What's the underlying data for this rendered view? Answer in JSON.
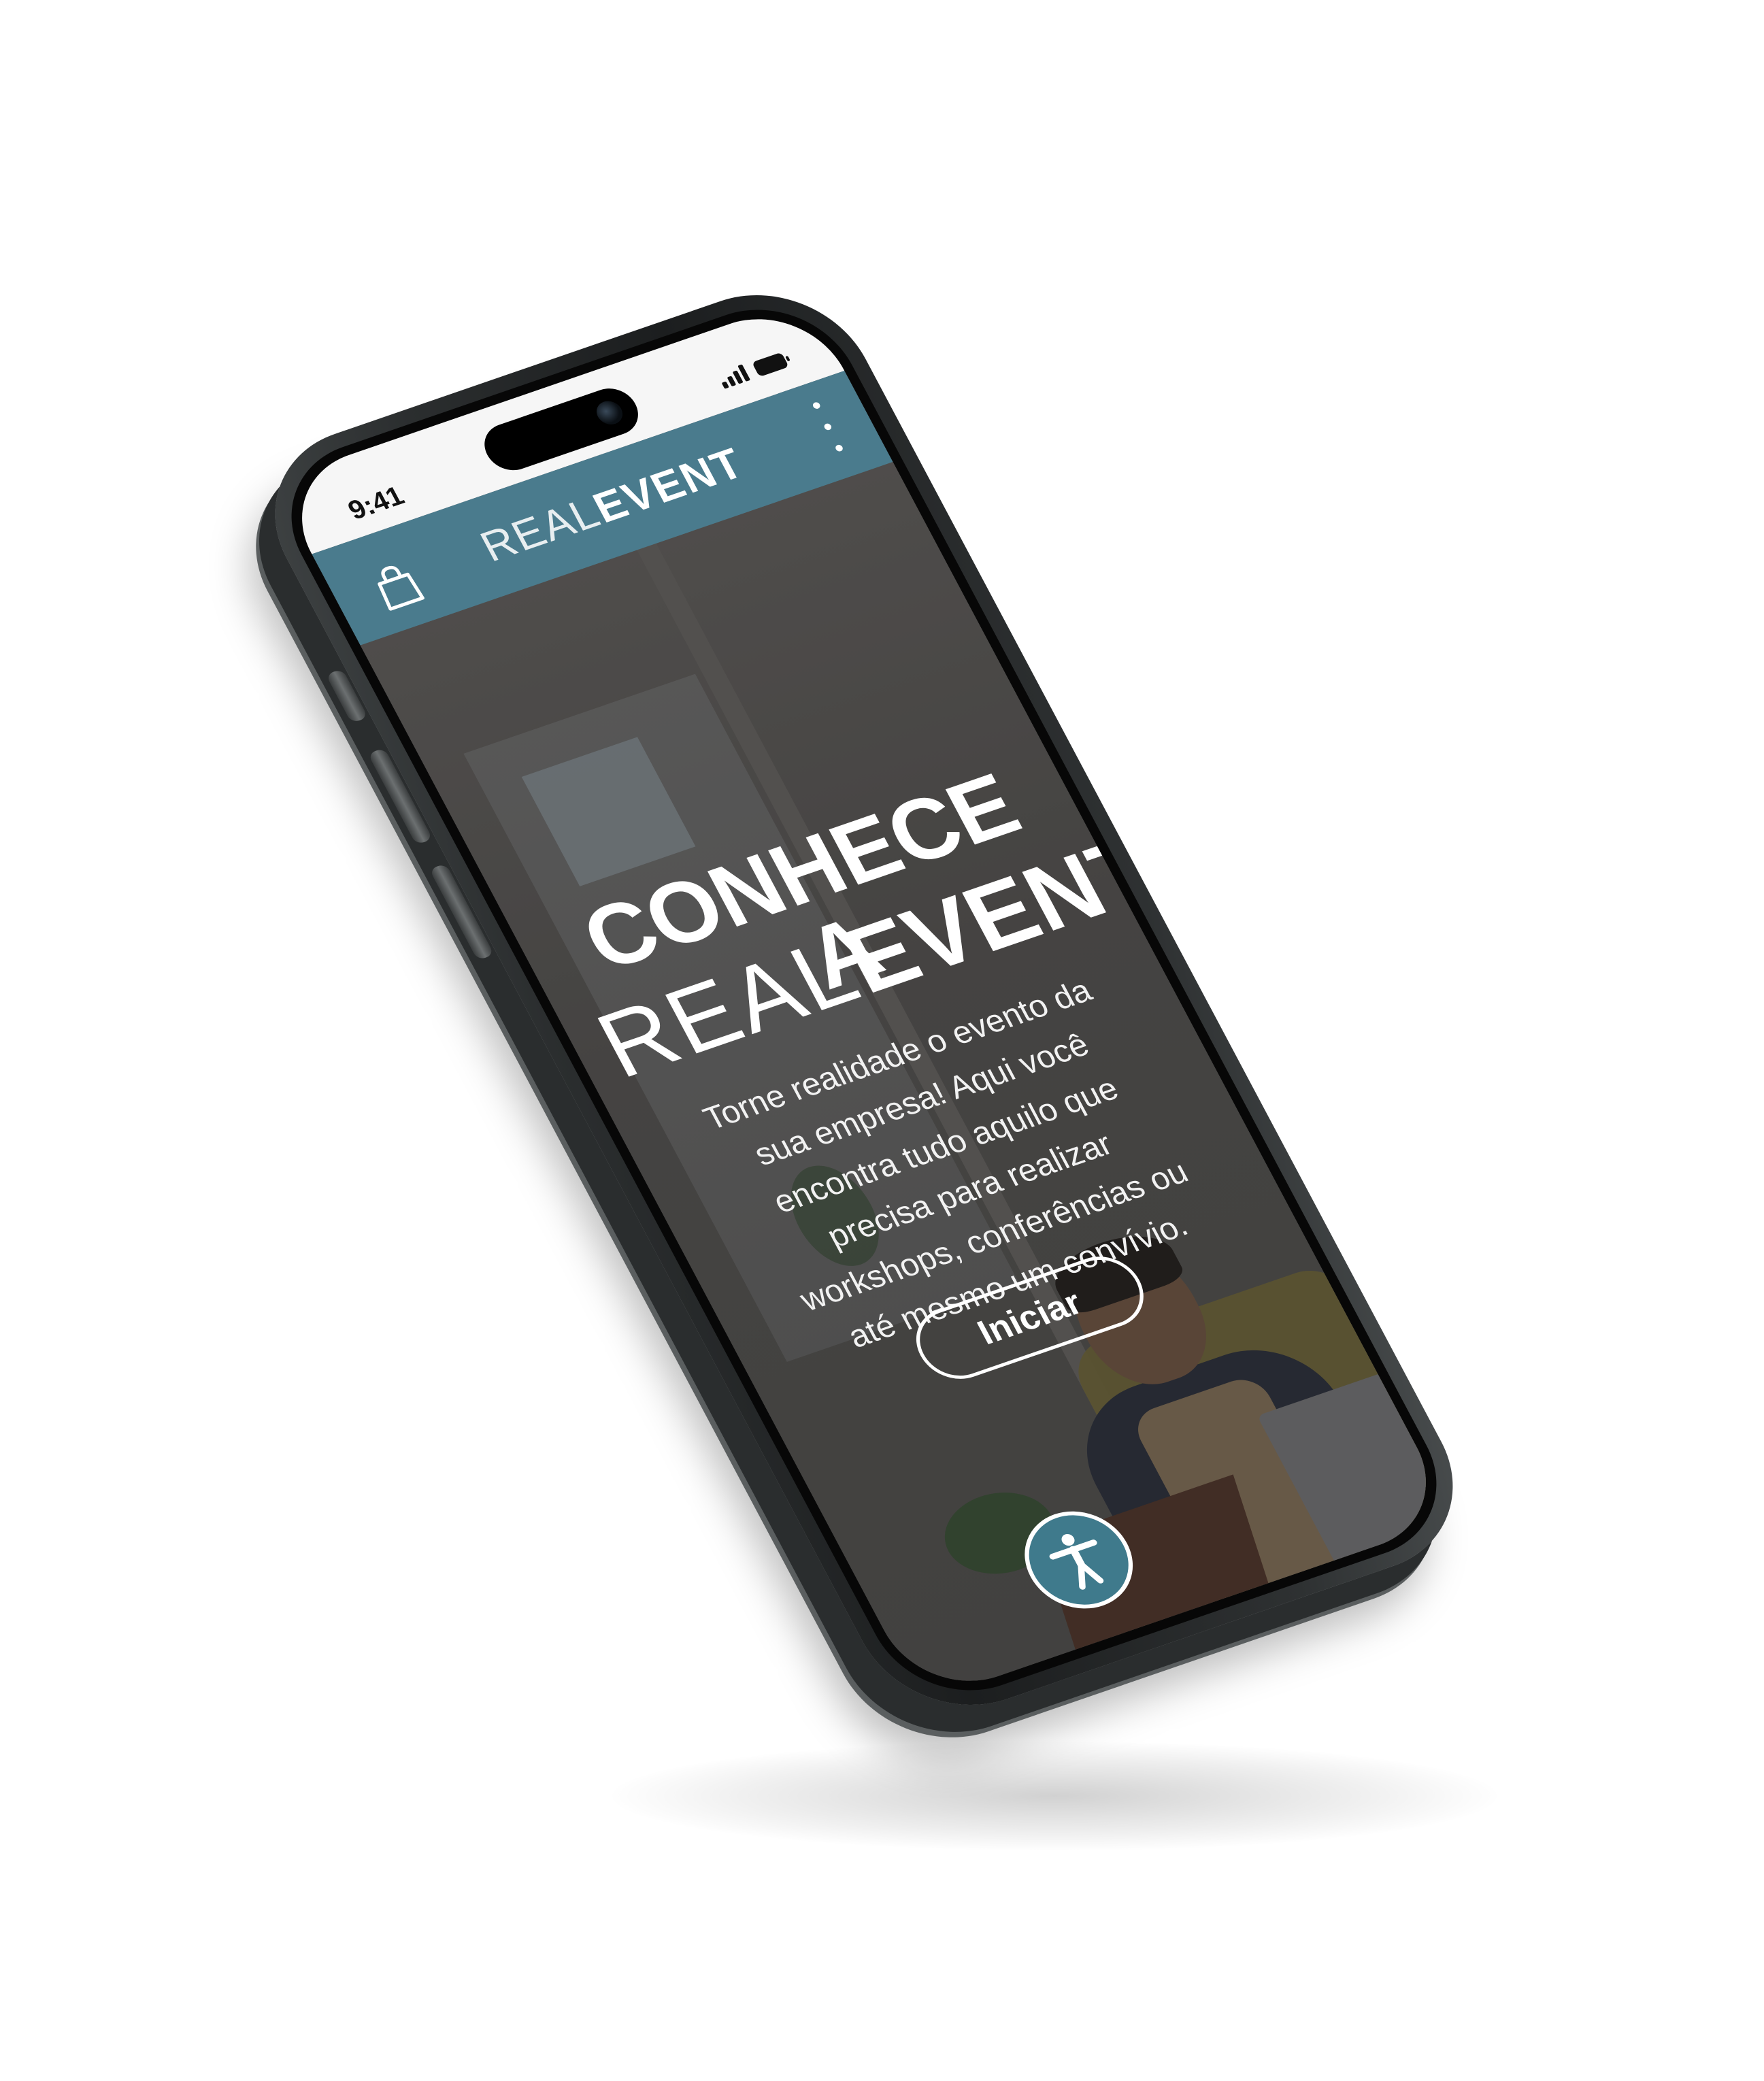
{
  "status_bar": {
    "time": "9:41"
  },
  "header": {
    "logo_light": "REAL",
    "logo_bold": "EVENT",
    "icons": [
      "shopping-bag-icon",
      "more-vertical-icon"
    ],
    "background_color": "#4a7b8d"
  },
  "hero": {
    "title": "CONHECE A",
    "logo_light": "REAL",
    "logo_bold": "EVENT",
    "description": "Torne realidade o evento da sua empresa! Aqui você encontra tudo aquilo que precisa para realizar workshops, conferências ou até mesmo um convívio.",
    "cta_label": "Iniciar",
    "accent_color": "#4a95a8"
  },
  "accessibility": {
    "icon": "accessibility-icon",
    "background_color": "#3f7a8c"
  }
}
